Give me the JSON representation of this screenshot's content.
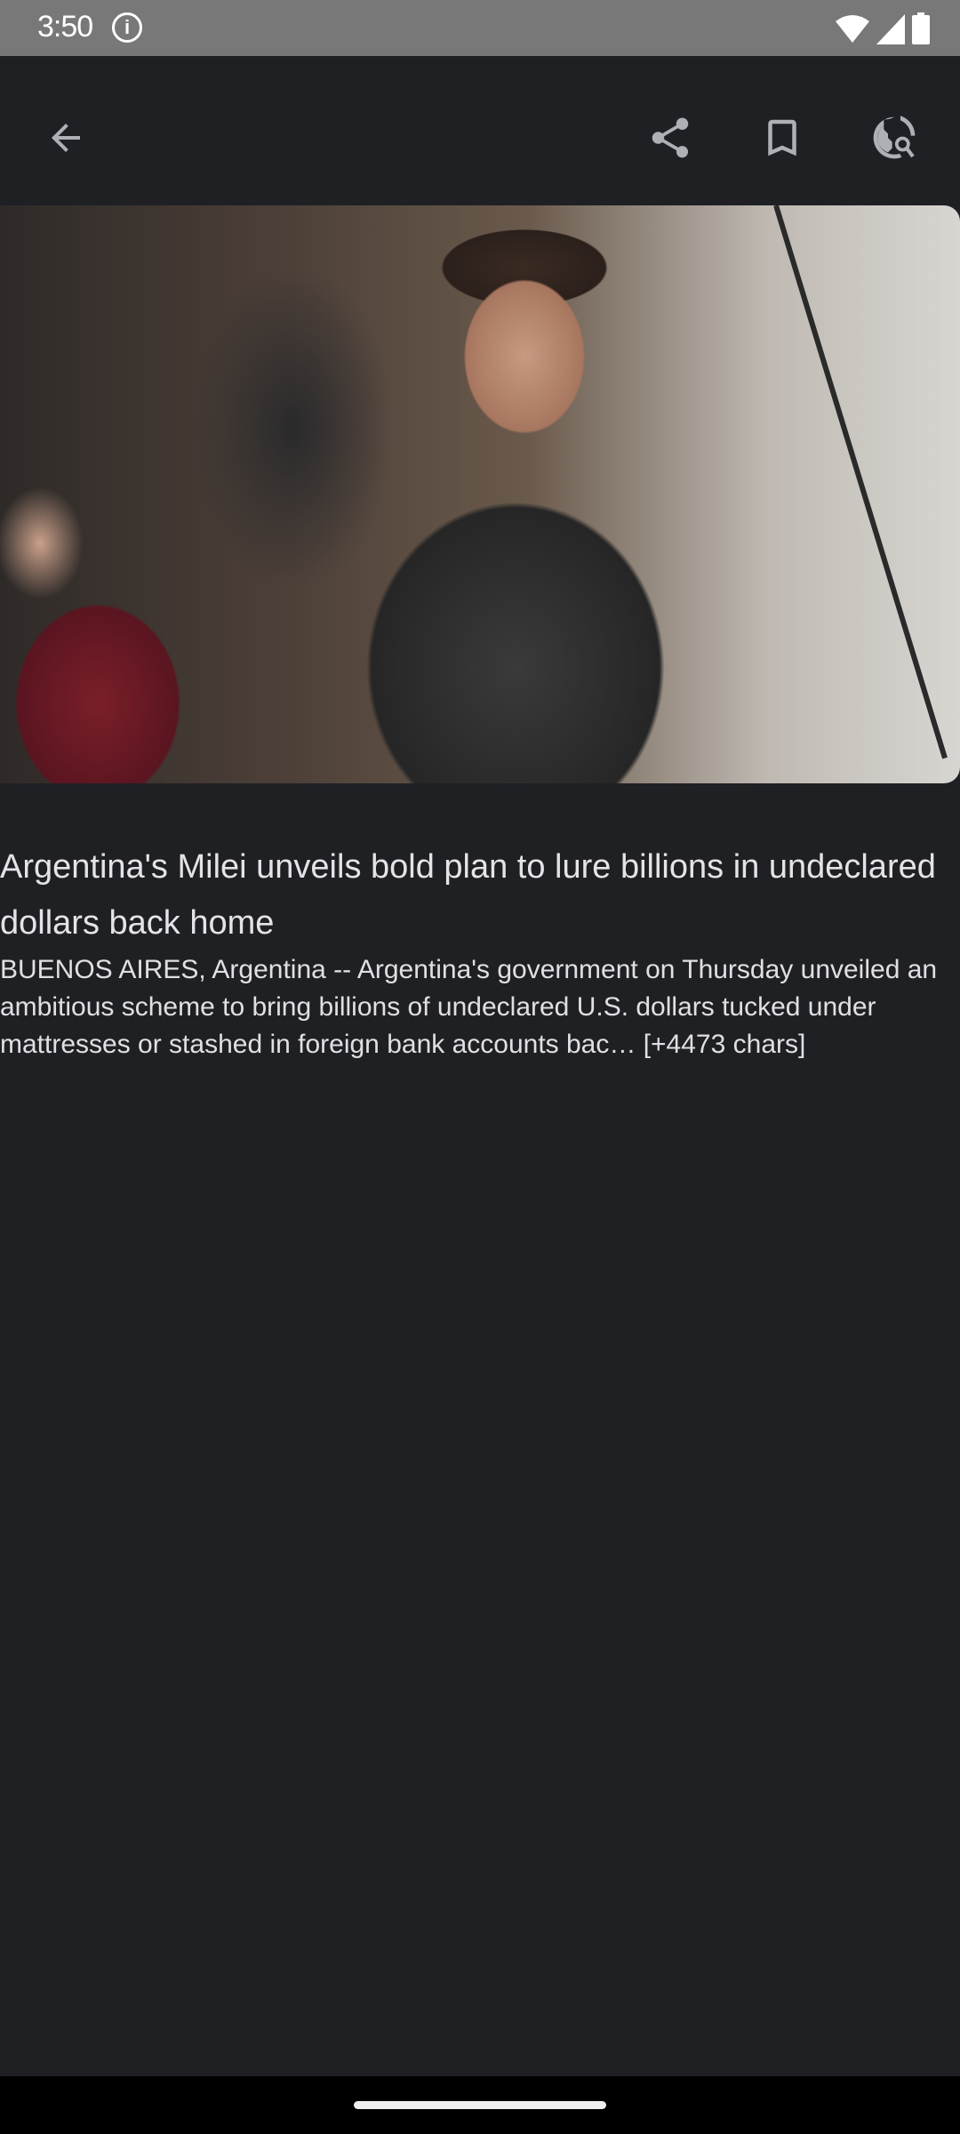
{
  "status_bar": {
    "time": "3:50",
    "info_icon": "info-circle-icon",
    "wifi_icon": "wifi-icon",
    "signal_icon": "cellular-signal-icon",
    "battery_icon": "battery-icon"
  },
  "toolbar": {
    "back_icon": "arrow-back-icon",
    "share_icon": "share-icon",
    "bookmark_icon": "bookmark-icon",
    "browser_icon": "globe-search-icon"
  },
  "article": {
    "title": "Argentina's Milei unveils bold plan to lure billions in undeclared dollars back home",
    "description": "BUENOS AIRES, Argentina -- Argentina's government on Thursday unveiled an ambitious scheme to bring billions of undeclared U.S. dollars tucked under mattresses or stashed in foreign bank accounts bac… [+4473 chars]"
  },
  "colors": {
    "background": "#1f2024",
    "status_bar": "#787878",
    "icon": "#aeb0b5",
    "text": "#e4e3e8"
  }
}
